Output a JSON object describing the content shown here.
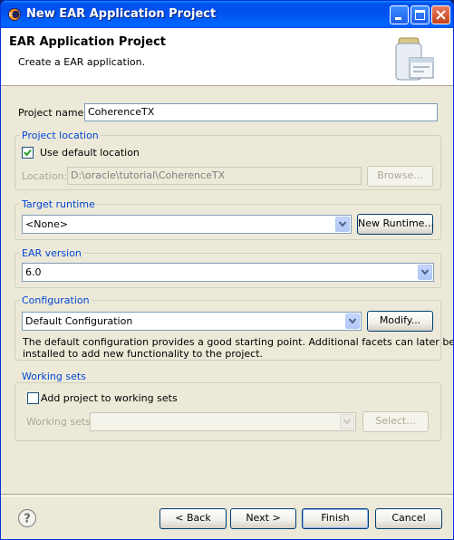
{
  "window": {
    "title": "New EAR Application Project",
    "icon": "eclipse-icon",
    "controls": [
      "minimize-icon",
      "maximize-icon",
      "close-icon"
    ]
  },
  "banner": {
    "title": "EAR Application Project",
    "description": "Create a EAR application.",
    "image": "jar-wizard-icon"
  },
  "project_name": {
    "label": "Project name:",
    "value": "CoherenceTX"
  },
  "project_location": {
    "title": "Project location",
    "use_default_label": "Use default location",
    "use_default_checked": true,
    "location_label": "Location:",
    "location_value": "D:\\oracle\\tutorial\\CoherenceTX",
    "browse_label": "Browse..."
  },
  "target_runtime": {
    "title": "Target runtime",
    "selected": "<None>",
    "new_runtime_label": "New Runtime..."
  },
  "ear_version": {
    "title": "EAR version",
    "selected": "6.0"
  },
  "configuration": {
    "title": "Configuration",
    "selected": "Default Configuration",
    "modify_label": "Modify...",
    "description_line1": "The default configuration provides a good starting point. Additional facets can later be",
    "description_line2": "installed to add new functionality to the project."
  },
  "working_sets": {
    "title": "Working sets",
    "add_label": "Add project to working sets",
    "add_checked": false,
    "sets_label": "Working sets:",
    "sets_value": "",
    "select_label": "Select..."
  },
  "footer": {
    "help_icon": "help-icon",
    "back_label": "< Back",
    "next_label": "Next >",
    "finish_label": "Finish",
    "cancel_label": "Cancel"
  }
}
